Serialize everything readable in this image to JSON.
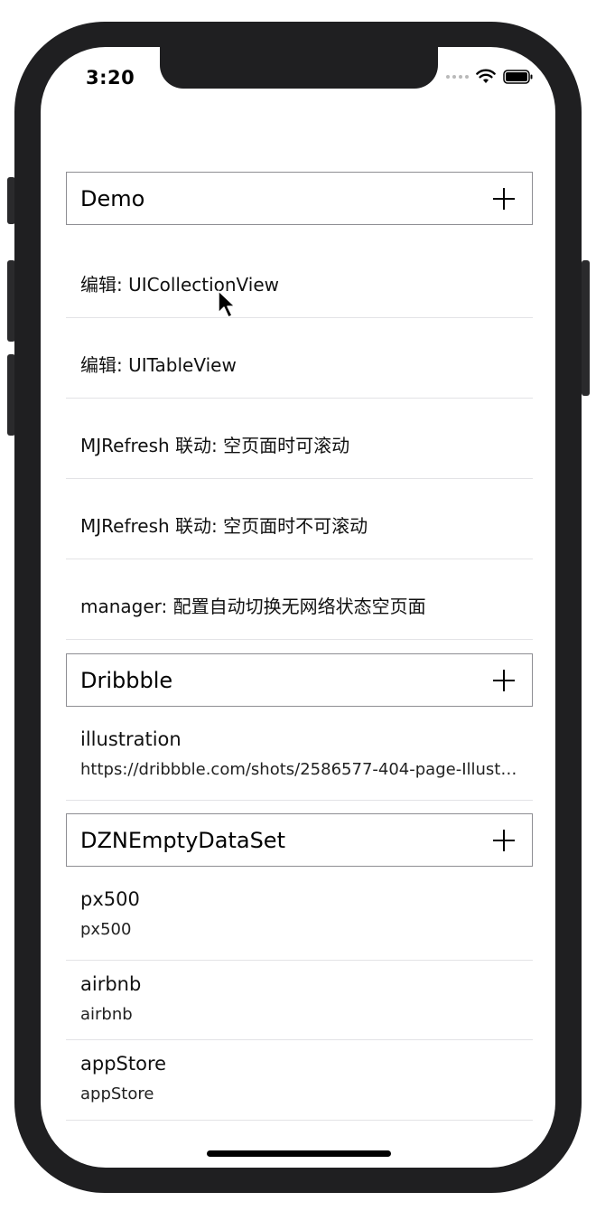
{
  "status_bar": {
    "time": "3:20"
  },
  "sections": [
    {
      "title": "Demo",
      "rows": [
        "编辑: UICollectionView",
        "编辑: UITableView",
        "MJRefresh 联动: 空页面时可滚动",
        "MJRefresh 联动: 空页面时不可滚动",
        "manager: 配置自动切换无网络状态空页面"
      ]
    },
    {
      "title": "Dribbble",
      "items": [
        {
          "title": "illustration",
          "detail": "https://dribbble.com/shots/2586577-404-page-Illustr..."
        }
      ]
    },
    {
      "title": "DZNEmptyDataSet",
      "items": [
        {
          "title": "px500",
          "detail": "px500"
        },
        {
          "title": "airbnb",
          "detail": "airbnb"
        },
        {
          "title": "appStore",
          "detail": "appStore"
        }
      ]
    }
  ],
  "icons": {
    "add": "plus-icon",
    "cursor": "mouse-pointer-icon",
    "wifi": "wifi-icon",
    "battery": "battery-icon"
  }
}
